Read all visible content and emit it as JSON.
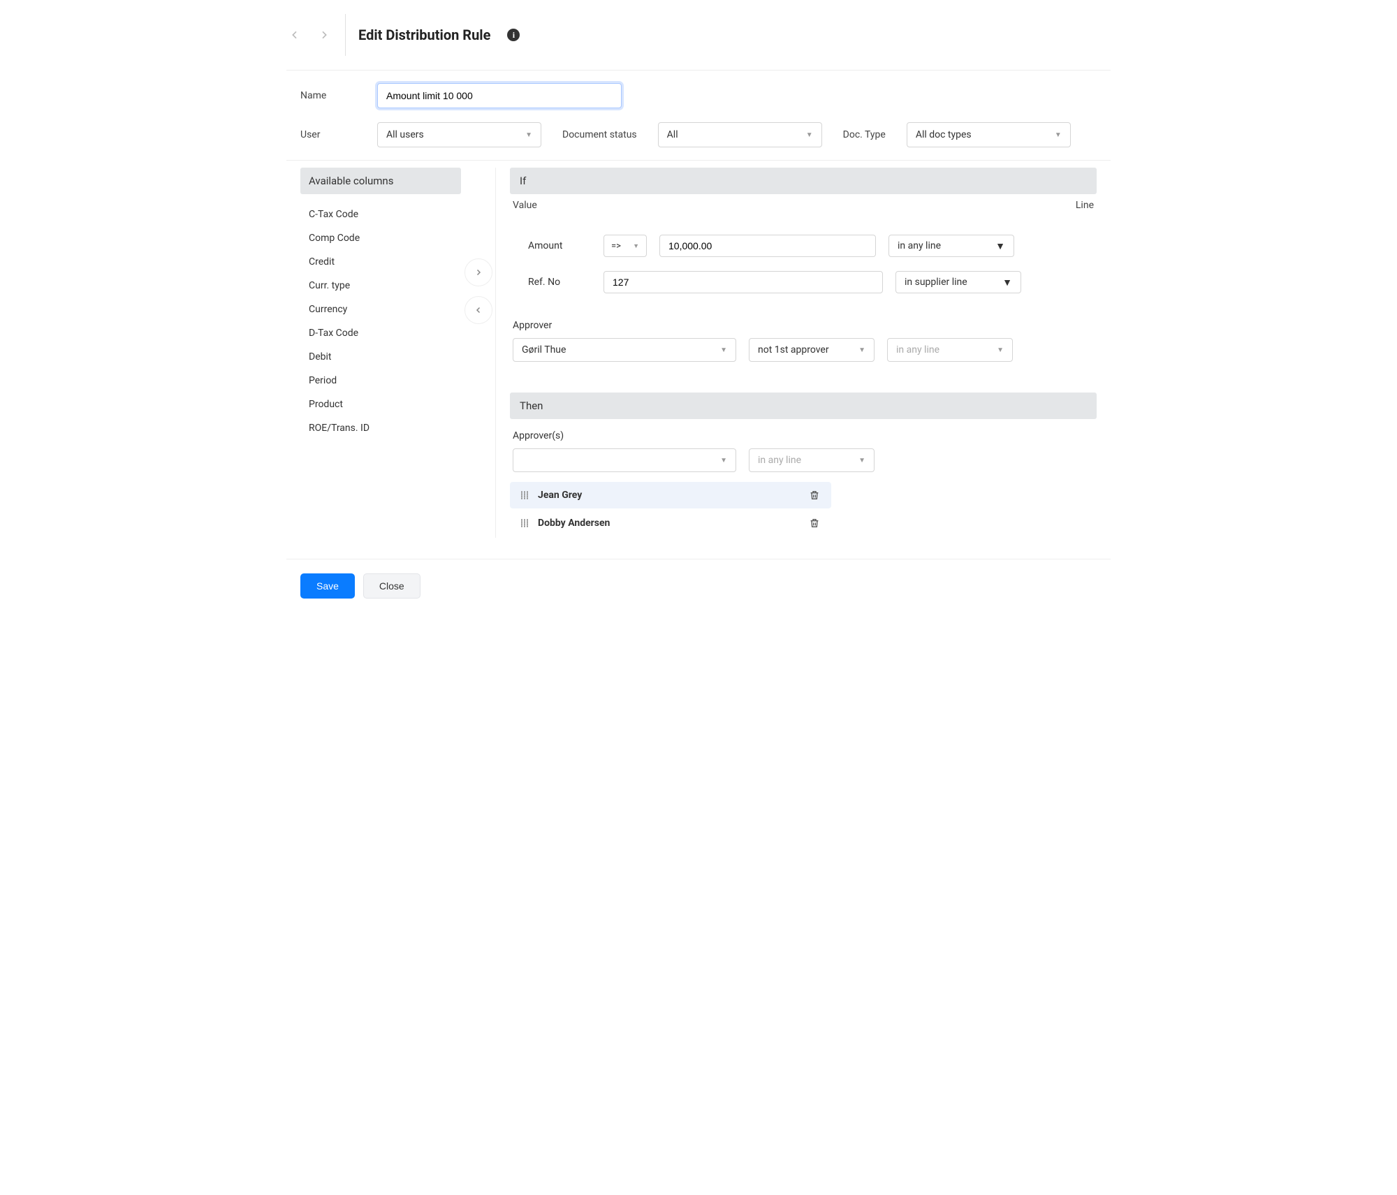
{
  "header": {
    "title": "Edit Distribution Rule"
  },
  "form": {
    "name_label": "Name",
    "name_value": "Amount limit 10 000",
    "user_label": "User",
    "user_value": "All users",
    "doc_status_label": "Document status",
    "doc_status_value": "All",
    "doc_type_label": "Doc. Type",
    "doc_type_value": "All doc types"
  },
  "sidebar": {
    "header": "Available columns",
    "items": [
      "C-Tax Code",
      "Comp Code",
      "Credit",
      "Curr. type",
      "Currency",
      "D-Tax Code",
      "Debit",
      "Period",
      "Product",
      "ROE/Trans. ID"
    ]
  },
  "if_section": {
    "title": "If",
    "value_label": "Value",
    "line_label": "Line",
    "rows": [
      {
        "label": "Amount",
        "op": "=>",
        "value": "10,000.00",
        "line": "in any line"
      },
      {
        "label": "Ref. No",
        "op": "",
        "value": "127",
        "line": "in supplier line"
      }
    ],
    "approver_label": "Approver",
    "approver_value": "Gøril Thue",
    "approver_role": "not 1st approver",
    "approver_line": "in any line"
  },
  "then_section": {
    "title": "Then",
    "approvers_label": "Approver(s)",
    "line_value": "in any line",
    "items": [
      "Jean Grey",
      "Dobby Andersen"
    ]
  },
  "footer": {
    "save": "Save",
    "close": "Close"
  }
}
